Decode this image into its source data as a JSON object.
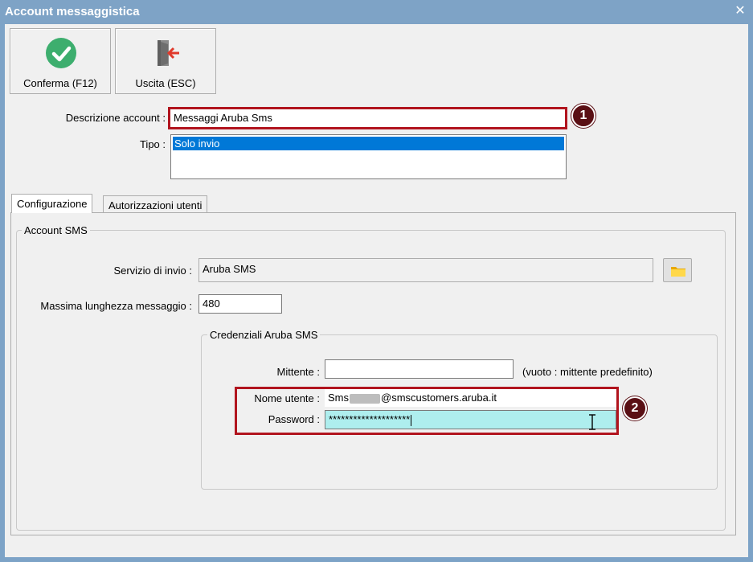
{
  "window": {
    "title": "Account messaggistica"
  },
  "toolbar": {
    "confirm_label": "Conferma (F12)",
    "exit_label": "Uscita (ESC)"
  },
  "form": {
    "account_description_label": "Descrizione account :",
    "account_description_value": "Messaggi Aruba Sms",
    "type_label": "Tipo :",
    "type_options": [
      "Solo invio"
    ],
    "type_selected": "Solo invio"
  },
  "tabs": [
    {
      "label": "Configurazione",
      "active": true
    },
    {
      "label": "Autorizzazioni utenti",
      "active": false
    }
  ],
  "sms_group": {
    "title": "Account SMS",
    "service_label": "Servizio di invio :",
    "service_value": "Aruba SMS",
    "max_length_label": "Massima lunghezza messaggio :",
    "max_length_value": "480"
  },
  "credentials_group": {
    "title": "Credenziali Aruba SMS",
    "sender_label": "Mittente :",
    "sender_value": "",
    "sender_hint": "(vuoto : mittente predefinito)",
    "username_label": "Nome utente :",
    "username_prefix": "Sms",
    "username_suffix": "@smscustomers.aruba.it",
    "password_label": "Password :",
    "password_value": "********************"
  },
  "annotations": {
    "badge_1": "1",
    "badge_2": "2"
  },
  "colors": {
    "titlebar": "#7ea3c6",
    "highlight_outline": "#b1141e",
    "badge": "#5a0f14",
    "selection": "#0078d7",
    "password_bg": "#aeeeee",
    "confirm_icon": "#3dae6e"
  },
  "icons": {
    "confirm": "check-circle-icon",
    "exit": "exit-door-icon",
    "folder": "folder-icon",
    "close": "close-icon",
    "cursor": "text-cursor-icon"
  }
}
